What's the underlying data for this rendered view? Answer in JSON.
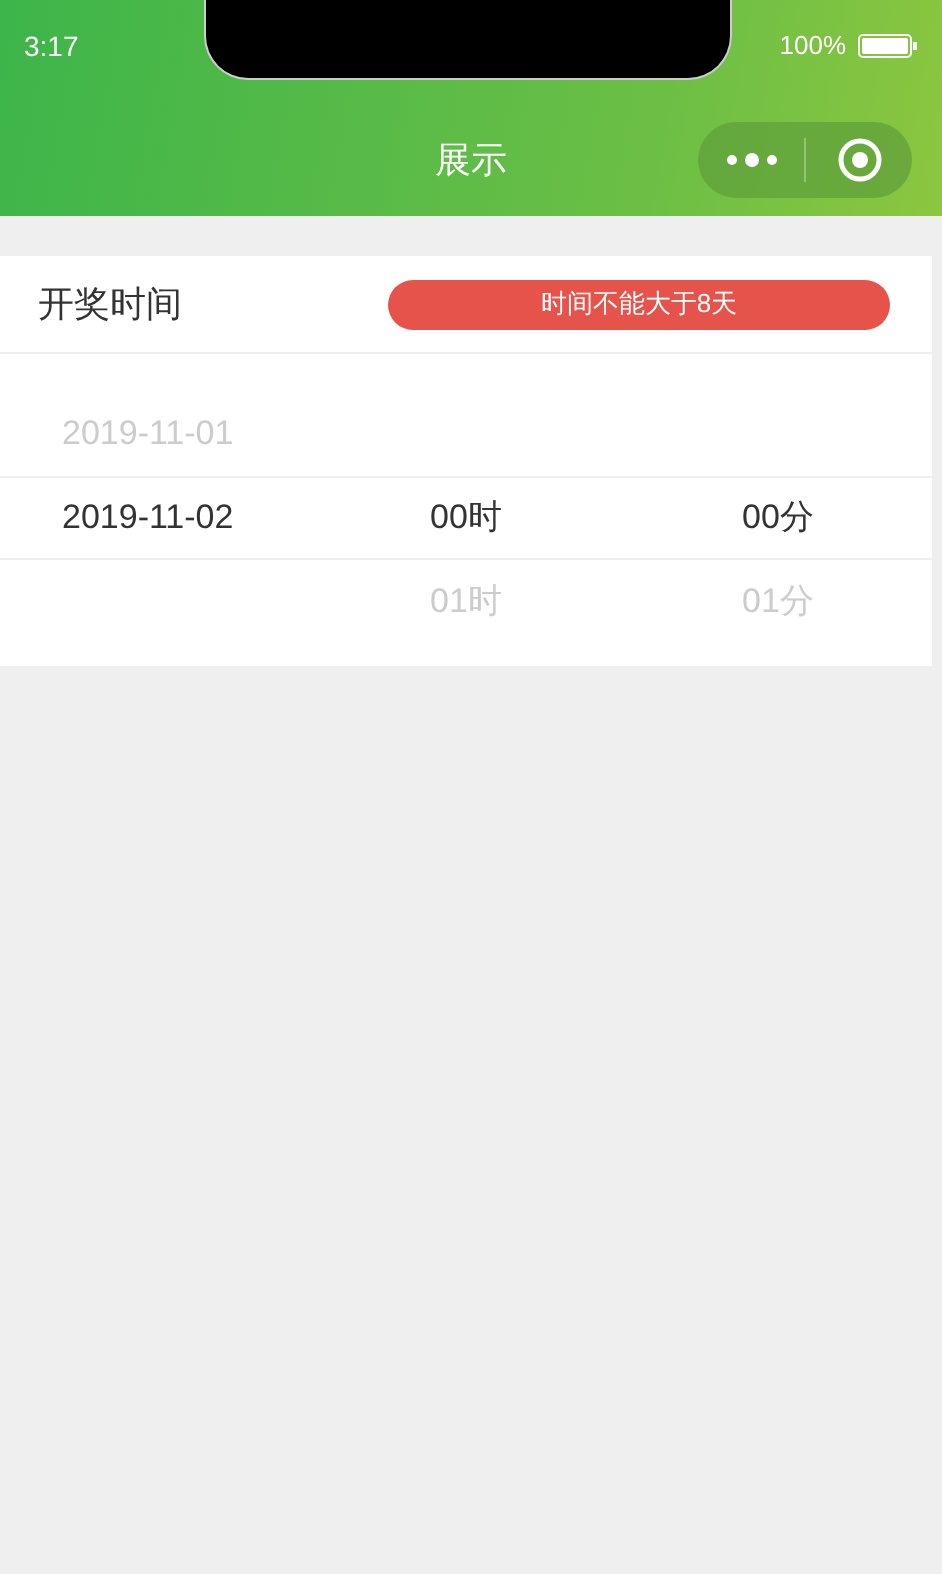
{
  "status_bar": {
    "time": "3:17",
    "battery": "100%"
  },
  "nav": {
    "title": "展示"
  },
  "form": {
    "label": "开奖时间",
    "warning": "时间不能大于8天"
  },
  "picker_rows": [
    {
      "date": "2019-11-01",
      "selected": false
    },
    {
      "date": "2019-11-02",
      "hour": "00时",
      "minute": "00分",
      "selected": true
    },
    {
      "hour": "01时",
      "minute": "01分",
      "selected": false
    }
  ]
}
